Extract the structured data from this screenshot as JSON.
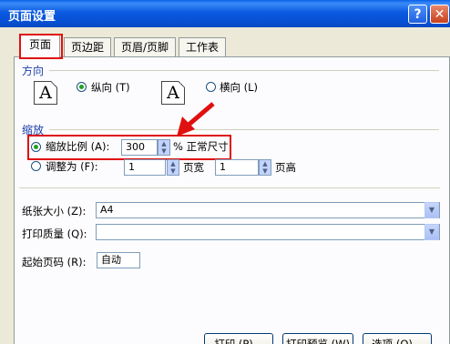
{
  "window": {
    "title": "页面设置",
    "help_glyph": "?",
    "close_glyph": "✕"
  },
  "tabs": [
    {
      "label": "页面",
      "active": true
    },
    {
      "label": "页边距",
      "active": false
    },
    {
      "label": "页眉/页脚",
      "active": false
    },
    {
      "label": "工作表",
      "active": false
    }
  ],
  "orientation": {
    "section_label": "方向",
    "icon_letter": "A",
    "portrait_label": "纵向 (T)",
    "landscape_label": "横向 (L)",
    "selected": "portrait"
  },
  "scaling": {
    "section_label": "缩放",
    "adjust_to_label": "缩放比例 (A):",
    "adjust_to_value": "300",
    "percent_label": "% 正常尺寸",
    "fit_to_label": "调整为 (F):",
    "pages_wide_value": "1",
    "pages_wide_label": "页宽",
    "pages_tall_value": "1",
    "pages_tall_label": "页高",
    "selected": "adjust_to"
  },
  "paper_size": {
    "label": "纸张大小 (Z):",
    "value": "A4"
  },
  "print_quality": {
    "label": "打印质量 (Q):",
    "value": ""
  },
  "first_page_number": {
    "label": "起始页码 (R):",
    "value": "自动"
  },
  "buttons": {
    "print": "打印 (P)...",
    "preview": "打印预览 (W)",
    "options": "选项 (O)..."
  },
  "annotation": {
    "color": "#e01010"
  }
}
